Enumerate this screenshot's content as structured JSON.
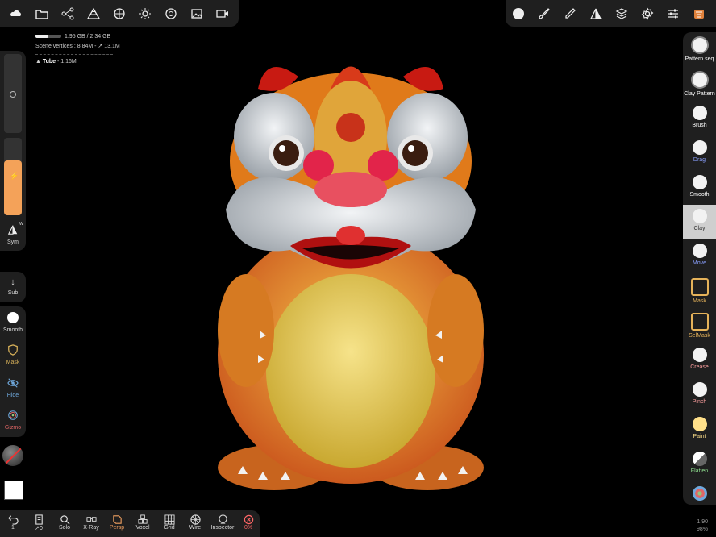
{
  "stats": {
    "memory": "1.95 GB / 2.34 GB",
    "scene_vertices": "Scene vertices :  8.84M - ↗ 13.1M",
    "object_name": "Tube",
    "object_vertices": "- 1.16M"
  },
  "top_left_icons": [
    "cloud-icon",
    "folder-icon",
    "scene-graph-icon",
    "topology-icon",
    "material-icon",
    "light-icon",
    "camera-icon",
    "image-icon",
    "video-icon"
  ],
  "top_right_icons": [
    "brush-sphere-icon",
    "paint-brush-icon",
    "dropper-icon",
    "symmetry-icon",
    "layers-icon",
    "settings-icon",
    "sliders-icon",
    "app-icon"
  ],
  "left": {
    "sym_label": "Sym",
    "sym_badge": "W",
    "sub_label": "Sub",
    "tools": [
      {
        "label": "Smooth",
        "color": "#ffffff"
      },
      {
        "label": "Mask",
        "color": "#d9b25a"
      },
      {
        "label": "Hide",
        "color": "#6fa8dc"
      },
      {
        "label": "Gizmo",
        "color": "#e06666"
      }
    ]
  },
  "right_tools": [
    {
      "label": "Pattern seq",
      "color": "#ffffff",
      "active": false
    },
    {
      "label": "Clay Pattern",
      "color": "#ffffff",
      "active": false
    },
    {
      "label": "Brush",
      "color": "#ffffff",
      "active": false
    },
    {
      "label": "Drag",
      "color": "#8aa0ff",
      "active": false
    },
    {
      "label": "Smooth",
      "color": "#ffffff",
      "active": false
    },
    {
      "label": "Clay",
      "color": "#ffffff",
      "active": true
    },
    {
      "label": "Move",
      "color": "#8aa0ff",
      "active": false
    },
    {
      "label": "Mask",
      "color": "#e6b35a",
      "active": false
    },
    {
      "label": "SelMask",
      "color": "#e6b35a",
      "active": false
    },
    {
      "label": "Crease",
      "color": "#ff9f9f",
      "active": false
    },
    {
      "label": "Pinch",
      "color": "#ff9f9f",
      "active": false
    },
    {
      "label": "Paint",
      "color": "#ffe08a",
      "active": false
    },
    {
      "label": "Flatten",
      "color": "#8fe08f",
      "active": false
    }
  ],
  "bottom_tools": [
    {
      "label": "1",
      "icon": "undo-icon",
      "color": "#dddddd"
    },
    {
      "label": "↗0",
      "icon": "history-icon",
      "color": "#dddddd"
    },
    {
      "label": "Solo",
      "icon": "solo-icon",
      "color": "#dddddd"
    },
    {
      "label": "X-Ray",
      "icon": "xray-icon",
      "color": "#dddddd"
    },
    {
      "label": "Persp",
      "icon": "perspective-icon",
      "color": "#f0a060"
    },
    {
      "label": "Voxel",
      "icon": "voxel-icon",
      "color": "#dddddd"
    },
    {
      "label": "Grid",
      "icon": "grid-icon",
      "color": "#dddddd"
    },
    {
      "label": "Wire",
      "icon": "wireframe-icon",
      "color": "#dddddd"
    },
    {
      "label": "Inspector",
      "icon": "inspector-icon",
      "color": "#dddddd"
    },
    {
      "label": "0%",
      "icon": "close-circle-icon",
      "color": "#ff6666"
    }
  ],
  "corner": {
    "line1": "1.90",
    "line2": "98%"
  }
}
